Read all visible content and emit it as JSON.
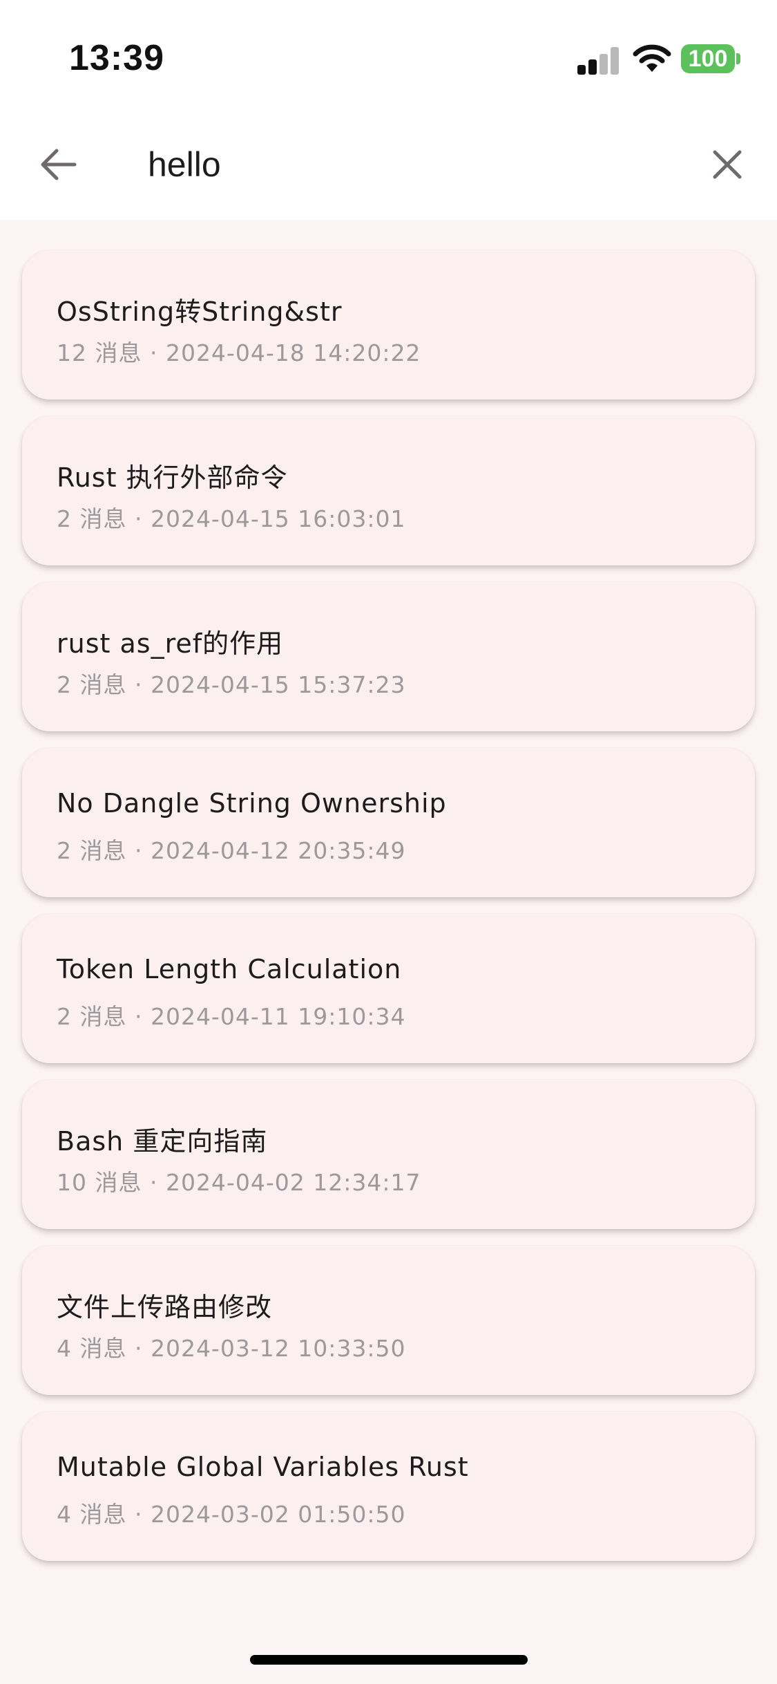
{
  "status_bar": {
    "time": "13:39",
    "battery": "100",
    "icons": [
      "signal-icon",
      "wifi-icon",
      "battery-icon"
    ],
    "battery_color": "#5cc15c"
  },
  "search": {
    "value": "hello",
    "back_icon": "arrow-left-icon",
    "clear_icon": "close-icon"
  },
  "conversations": [
    {
      "title": "OsString转String&str",
      "meta": "12 消息 · 2024-04-18 14:20:22"
    },
    {
      "title": "Rust 执行外部命令",
      "meta": "2 消息 · 2024-04-15 16:03:01"
    },
    {
      "title": "rust as_ref的作用",
      "meta": "2 消息 · 2024-04-15 15:37:23"
    },
    {
      "title": "No Dangle String Ownership",
      "meta": "2 消息 · 2024-04-12 20:35:49"
    },
    {
      "title": "Token Length Calculation",
      "meta": "2 消息 · 2024-04-11 19:10:34"
    },
    {
      "title": "Bash 重定向指南",
      "meta": "10 消息 · 2024-04-02 12:34:17"
    },
    {
      "title": "文件上传路由修改",
      "meta": "4 消息 · 2024-03-12 10:33:50"
    },
    {
      "title": "Mutable Global Variables Rust",
      "meta": "4 消息 · 2024-03-02 01:50:50"
    }
  ],
  "colors": {
    "background": "#fcf3f4",
    "card": "#fbeff0",
    "title_text": "#1e1b1c",
    "meta_text": "#9e989a"
  }
}
